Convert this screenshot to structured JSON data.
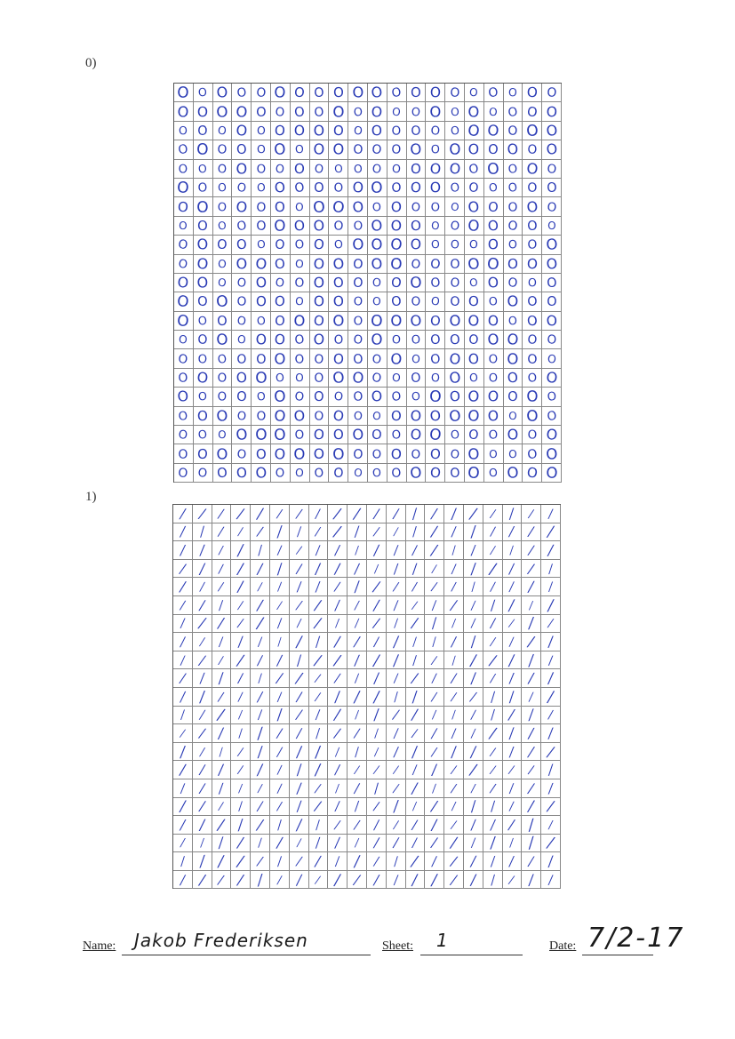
{
  "sections": [
    {
      "label": "0)",
      "glyph": "O",
      "rows": 21,
      "cols": 20
    },
    {
      "label": "1)",
      "glyph": "/",
      "rows": 21,
      "cols": 20
    }
  ],
  "footer": {
    "name_label": "Name:",
    "name_value": "Jakob Frederiksen",
    "sheet_label": "Sheet:",
    "sheet_value": "1",
    "date_label": "Date:",
    "date_value": "7/2-17"
  },
  "colors": {
    "ink": "#2a3bb5",
    "grid": "#888888"
  }
}
